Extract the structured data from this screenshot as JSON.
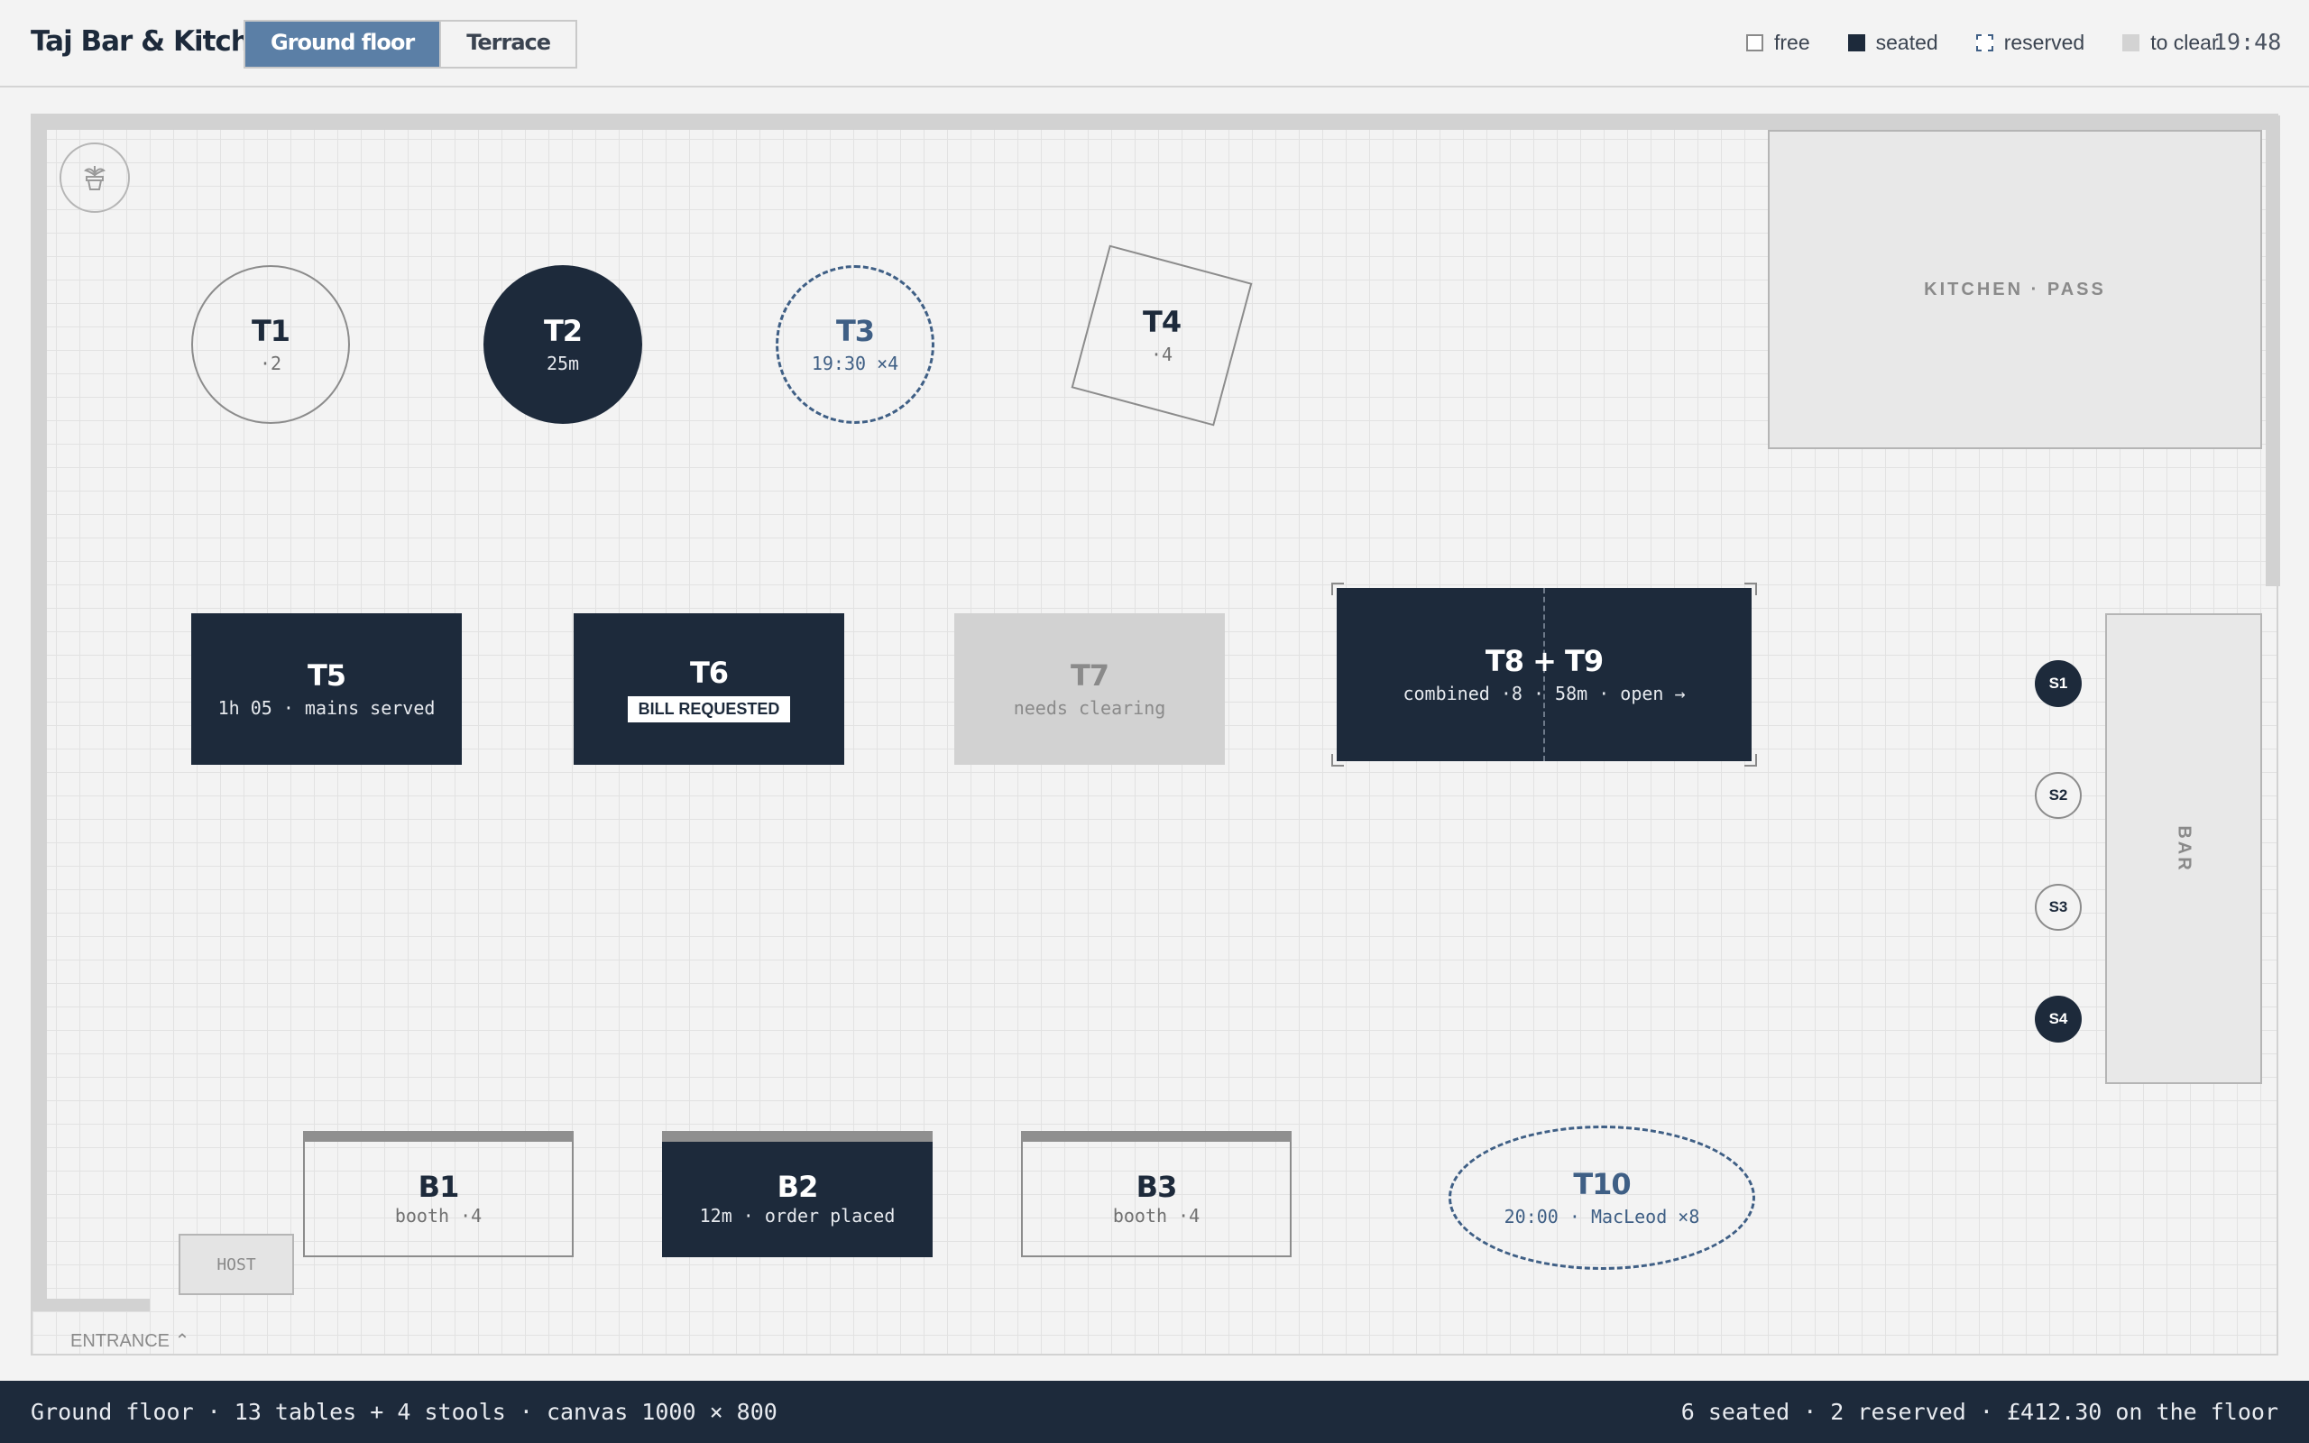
{
  "app": {
    "title": "Taj Bar & Kitchen",
    "clock": "19:48"
  },
  "floor_tabs": [
    {
      "label": "Ground floor",
      "active": true
    },
    {
      "label": "Terrace",
      "active": false
    }
  ],
  "legend": [
    {
      "label": "free"
    },
    {
      "label": "seated"
    },
    {
      "label": "reserved"
    },
    {
      "label": "to clear"
    }
  ],
  "tables": {
    "t1": {
      "name": "T1",
      "sub": "·2",
      "status": "free"
    },
    "t2": {
      "name": "T2",
      "sub": "25m",
      "status": "seated"
    },
    "t3": {
      "name": "T3",
      "sub": "19:30 ×4",
      "status": "reserved"
    },
    "t4": {
      "name": "T4",
      "sub": "·4",
      "status": "free"
    },
    "t5": {
      "name": "T5",
      "sub": "1h 05 · mains served",
      "status": "seated"
    },
    "t6": {
      "name": "T6",
      "badge": "BILL REQUESTED",
      "status": "seated"
    },
    "t7": {
      "name": "T7",
      "sub": "needs clearing",
      "status": "to clear"
    },
    "t89": {
      "name": "T8 + T9",
      "sub": "combined ·8 · 58m · open →",
      "status": "seated"
    },
    "b1": {
      "name": "B1",
      "sub": "booth ·4",
      "status": "free"
    },
    "b2": {
      "name": "B2",
      "sub": "12m · order placed",
      "status": "seated"
    },
    "b3": {
      "name": "B3",
      "sub": "booth ·4",
      "status": "free"
    },
    "t10": {
      "name": "T10",
      "sub": "20:00 · MacLeod ×8",
      "status": "reserved"
    }
  },
  "stools": [
    {
      "label": "S1",
      "status": "seated"
    },
    {
      "label": "S2",
      "status": "free"
    },
    {
      "label": "S3",
      "status": "free"
    },
    {
      "label": "S4",
      "status": "seated"
    }
  ],
  "zones": {
    "kitchen": "KITCHEN · PASS",
    "bar": "BAR",
    "host": "HOST",
    "entrance": "ENTRANCE"
  },
  "icons": {
    "plant": "plant-icon",
    "entrance": "chevron-up-icon"
  },
  "colors": {
    "seated": "#1d2a3b",
    "reserved": "#3f5f85",
    "to_clear": "#d2d2d2",
    "active_tab": "#5b7fa6"
  },
  "status_bar": {
    "left": "Ground floor · 13 tables + 4 stools · canvas 1000 × 800",
    "right": "6 seated · 2 reserved · £412.30 on the floor"
  }
}
